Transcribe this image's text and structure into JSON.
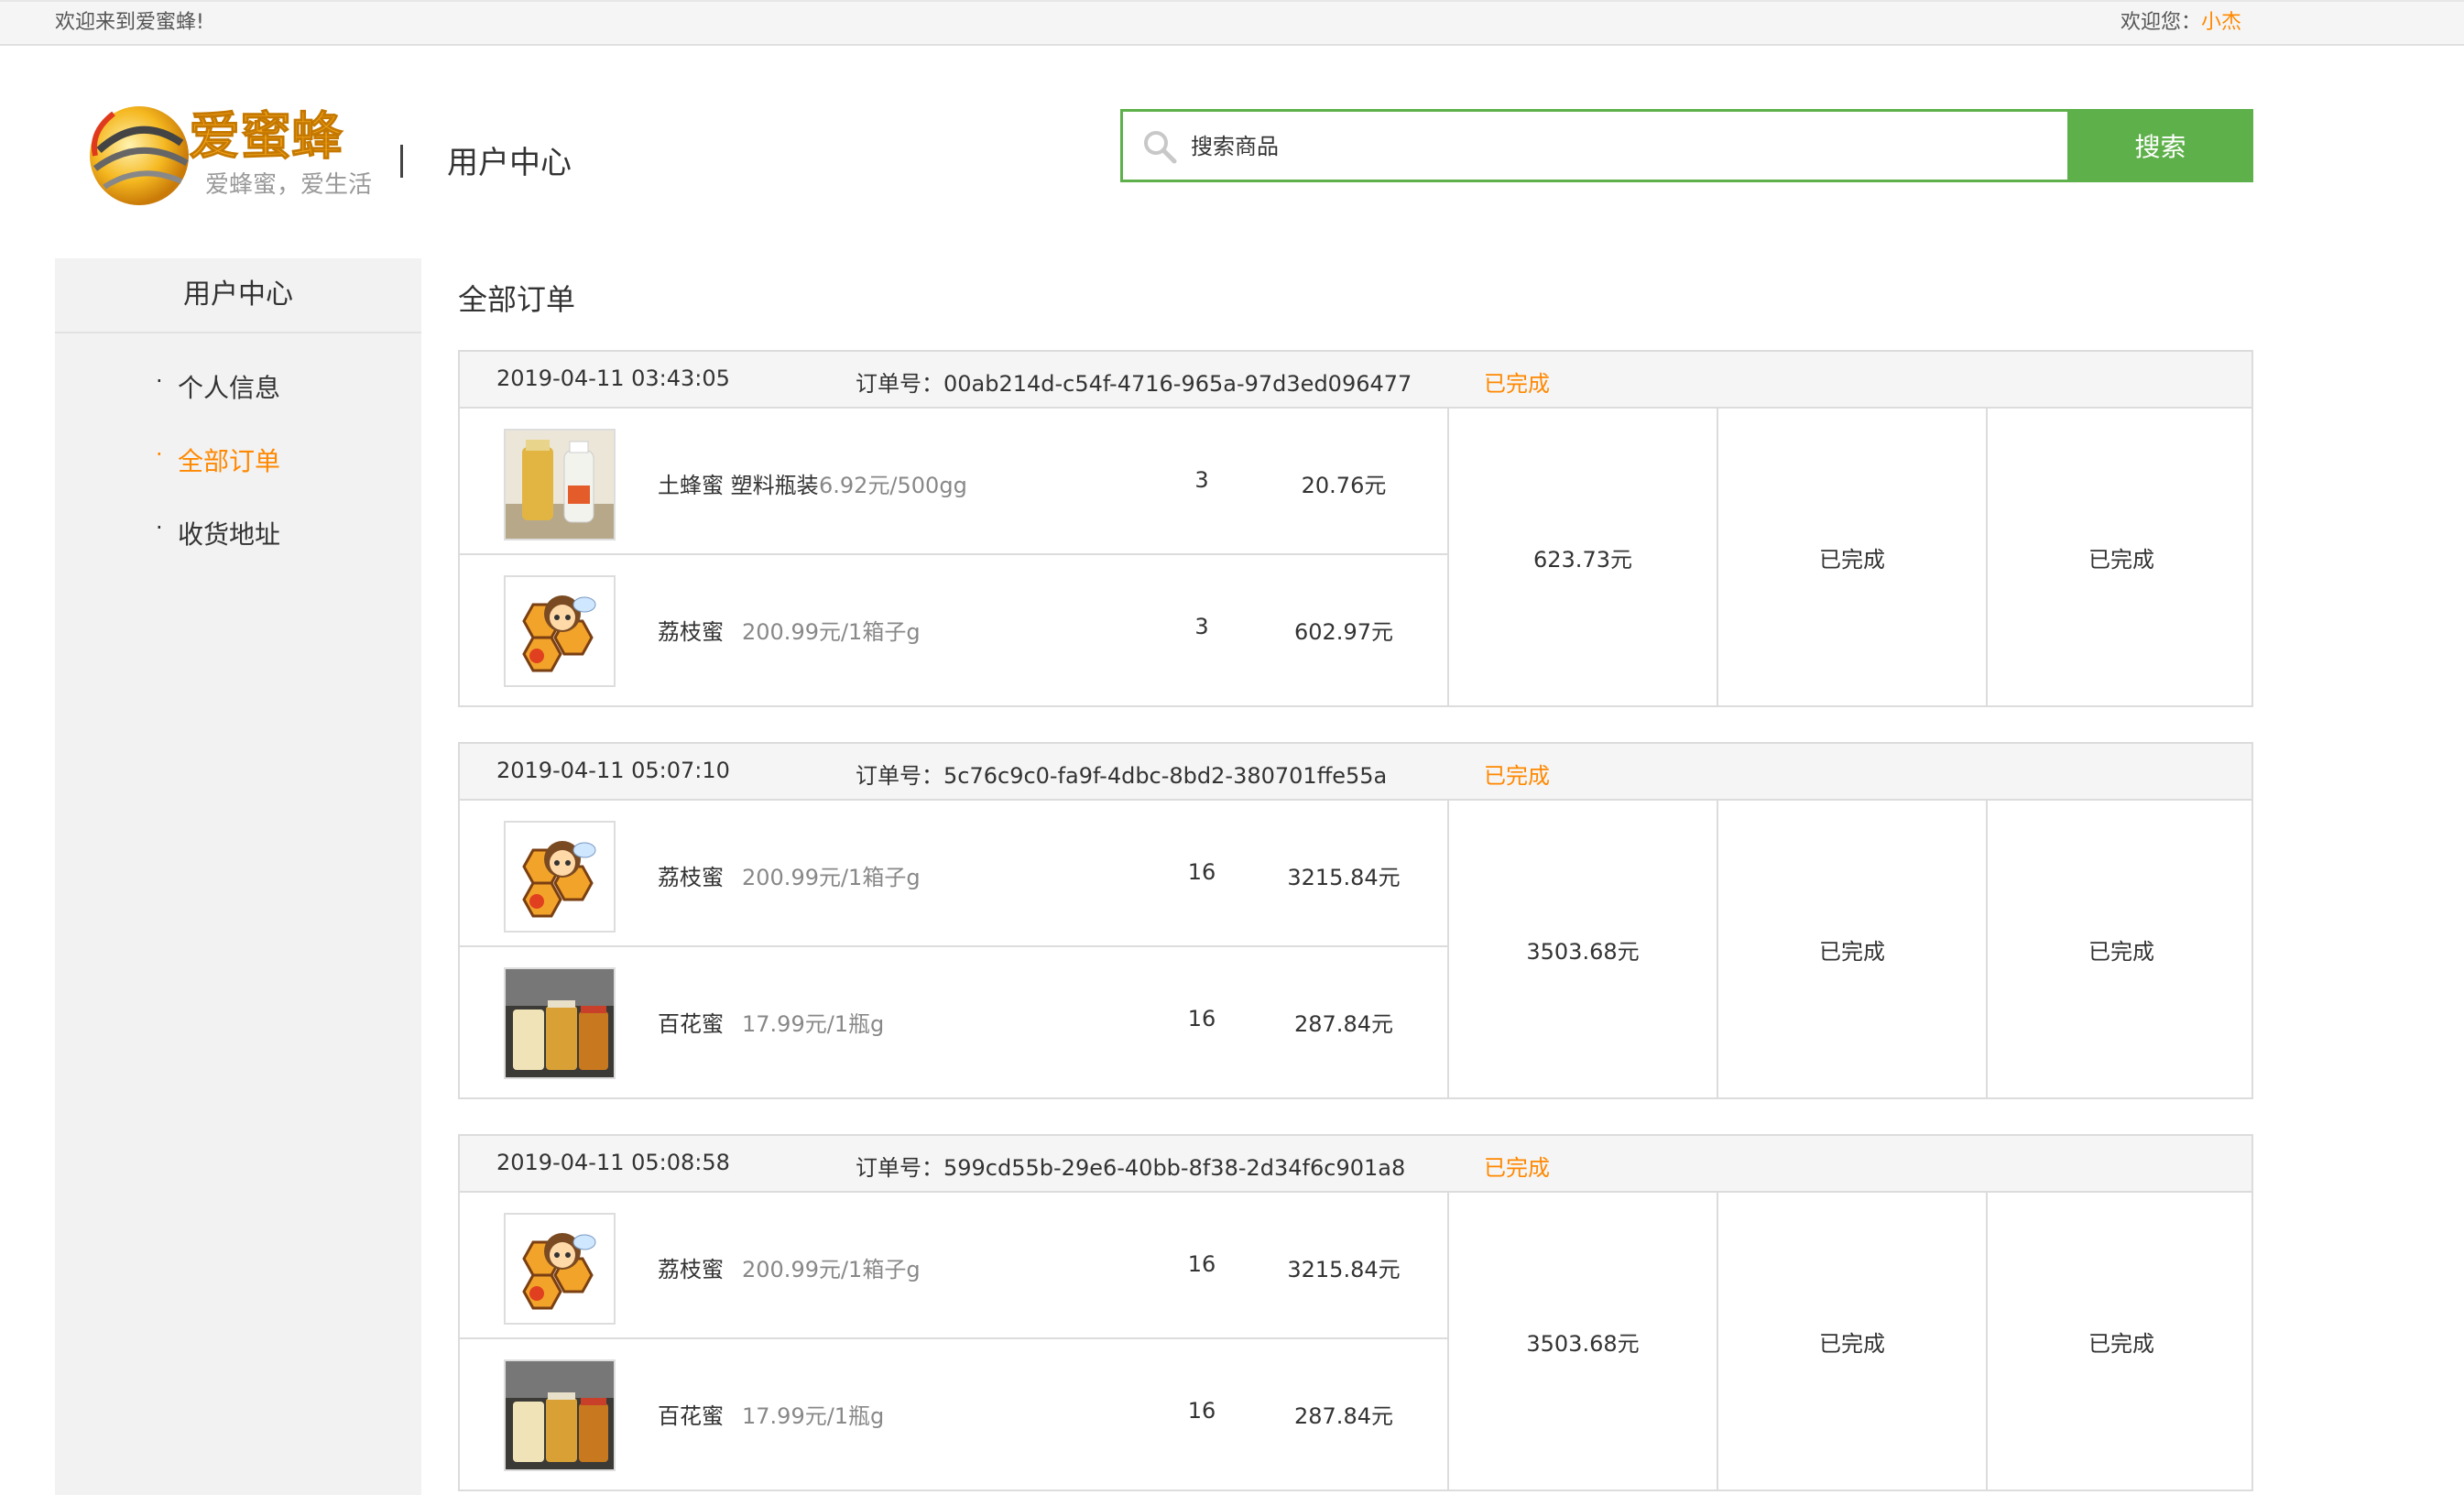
{
  "topbar": {
    "welcome": "欢迎来到爱蜜蜂!",
    "user_prefix": "欢迎您：",
    "user_name": "小杰"
  },
  "header": {
    "logo_text": "爱蜜蜂",
    "logo_slogan": "爱蜂蜜，爱生活",
    "page_heading": "用户中心",
    "search_placeholder": "搜索商品",
    "search_button": "搜索"
  },
  "sidebar": {
    "title": "用户中心",
    "items": [
      {
        "label": "个人信息",
        "active": false
      },
      {
        "label": "全部订单",
        "active": true
      },
      {
        "label": "收货地址",
        "active": false
      }
    ]
  },
  "main": {
    "title": "全部订单",
    "order_no_prefix": "订单号：",
    "orders": [
      {
        "time": "2019-04-11 03:43:05",
        "order_no": "00ab214d-c54f-4716-965a-97d3ed096477",
        "status": "已完成",
        "items": [
          {
            "name": "土蜂蜜 塑料瓶装",
            "price": "6.92元/500gg",
            "qty": "3",
            "subtotal": "20.76元",
            "image": "plastic-bottle-honey"
          },
          {
            "name": "荔枝蜜",
            "price": "200.99元/1箱子g",
            "qty": "3",
            "subtotal": "602.97元",
            "image": "bee-cartoon"
          }
        ],
        "total": "623.73元",
        "col2": "已完成",
        "col3": "已完成"
      },
      {
        "time": "2019-04-11 05:07:10",
        "order_no": "5c76c9c0-fa9f-4dbc-8bd2-380701ffe55a",
        "status": "已完成",
        "items": [
          {
            "name": "荔枝蜜",
            "price": "200.99元/1箱子g",
            "qty": "16",
            "subtotal": "3215.84元",
            "image": "bee-cartoon"
          },
          {
            "name": "百花蜜",
            "price": "17.99元/1瓶g",
            "qty": "16",
            "subtotal": "287.84元",
            "image": "honey-jars"
          }
        ],
        "total": "3503.68元",
        "col2": "已完成",
        "col3": "已完成"
      },
      {
        "time": "2019-04-11 05:08:58",
        "order_no": "599cd55b-29e6-40bb-8f38-2d34f6c901a8",
        "status": "已完成",
        "items": [
          {
            "name": "荔枝蜜",
            "price": "200.99元/1箱子g",
            "qty": "16",
            "subtotal": "3215.84元",
            "image": "bee-cartoon"
          },
          {
            "name": "百花蜜",
            "price": "17.99元/1瓶g",
            "qty": "16",
            "subtotal": "287.84元",
            "image": "honey-jars"
          }
        ],
        "total": "3503.68元",
        "col2": "已完成",
        "col3": "已完成"
      }
    ]
  },
  "colors": {
    "accent": "#ff8800",
    "brand_green": "#5eb04a"
  }
}
